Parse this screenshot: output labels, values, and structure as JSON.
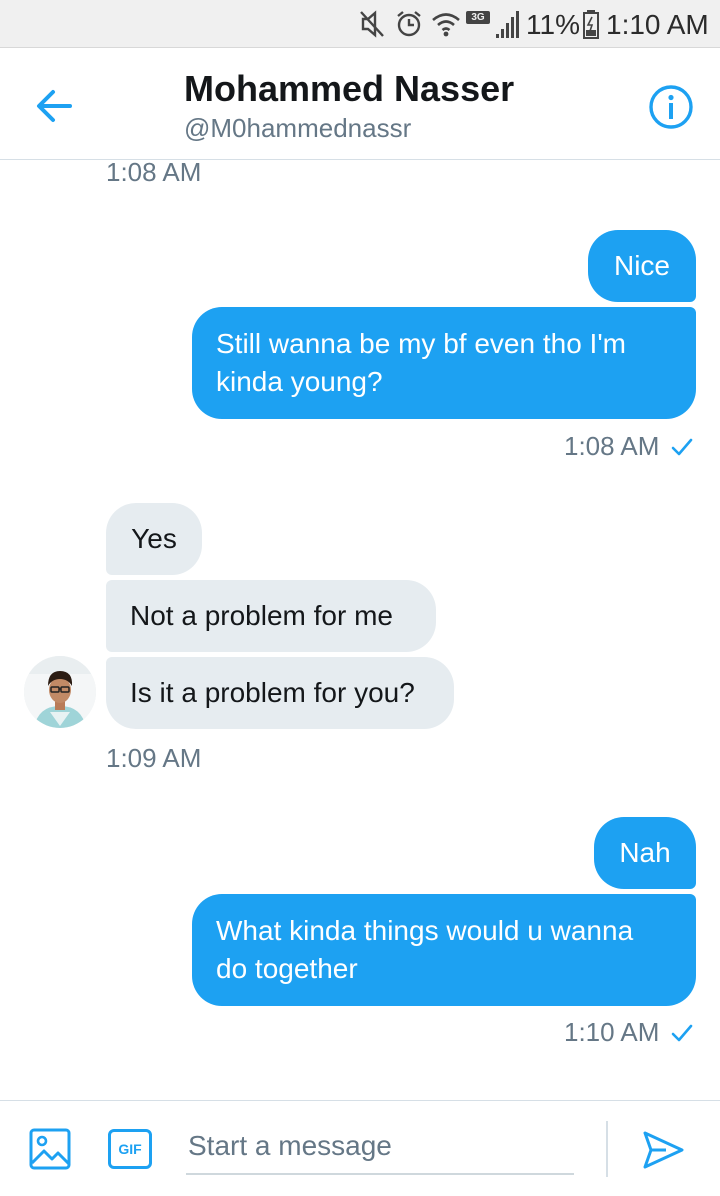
{
  "status_bar": {
    "battery": "11%",
    "time": "1:10 AM",
    "network": "3G",
    "icons": [
      "mute-icon",
      "alarm-icon",
      "wifi-icon",
      "signal-icon",
      "battery-icon"
    ]
  },
  "header": {
    "name": "Mohammed Nasser",
    "handle": "@M0hammednassr",
    "back_icon": "arrow-left-icon",
    "info_icon": "info-icon"
  },
  "conversation": {
    "top_timestamp": "1:08 AM",
    "groups": [
      {
        "direction": "sent",
        "messages": [
          "Nice",
          "Still wanna be my bf even tho I'm kinda young?"
        ],
        "timestamp": "1:08 AM",
        "read": true
      },
      {
        "direction": "received",
        "messages": [
          "Yes",
          "Not a problem for me",
          "Is it a problem for you?"
        ],
        "timestamp": "1:09 AM"
      },
      {
        "direction": "sent",
        "messages": [
          "Nah",
          "What kinda things would u wanna do together"
        ],
        "timestamp": "1:10 AM",
        "read": true
      }
    ]
  },
  "composer": {
    "placeholder": "Start a message",
    "gif_label": "GIF",
    "media_icon": "image-icon",
    "send_icon": "send-icon"
  },
  "colors": {
    "accent": "#1da1f2",
    "received_bubble": "#e6ecf0",
    "text_primary": "#14171a",
    "text_secondary": "#657786"
  }
}
